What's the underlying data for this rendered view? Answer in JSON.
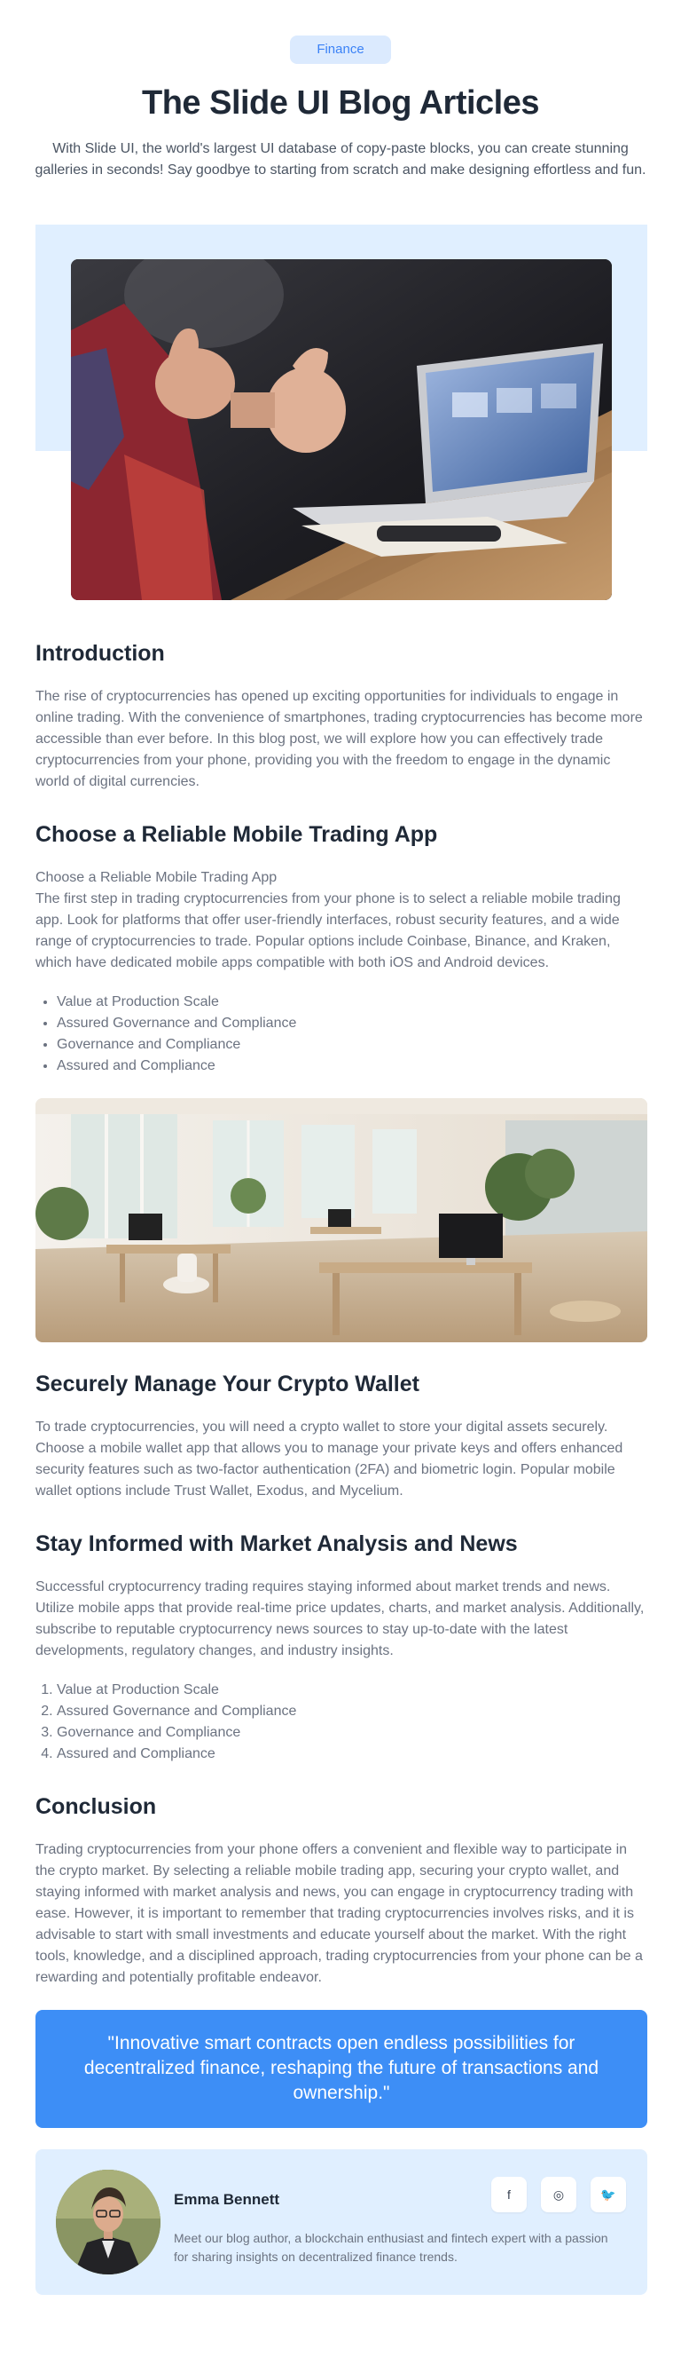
{
  "header": {
    "tag": "Finance",
    "title": "The Slide UI Blog Articles",
    "subtitle": "With Slide UI, the world's largest UI database of copy-paste blocks, you can create stunning galleries in seconds! Say goodbye to starting from scratch and make designing effortless and fun."
  },
  "sections": {
    "intro": {
      "heading": "Introduction",
      "body": "The rise of cryptocurrencies has opened up exciting opportunities for individuals to engage in online trading. With the convenience of smartphones, trading cryptocurrencies has become more accessible than ever before. In this blog post, we will explore how you can effectively trade cryptocurrencies from your phone, providing you with the freedom to engage in the dynamic world of digital currencies."
    },
    "choose": {
      "heading": "Choose a Reliable Mobile Trading App",
      "subheading": "Choose a Reliable Mobile Trading App",
      "body": "The first step in trading cryptocurrencies from your phone is to select a reliable mobile trading app. Look for platforms that offer user-friendly interfaces, robust security features, and a wide range of cryptocurrencies to trade. Popular options include Coinbase, Binance, and Kraken, which have dedicated mobile apps compatible with both iOS and Android devices.",
      "list": [
        "Value at Production Scale",
        "Assured Governance and Compliance",
        "Governance and Compliance",
        "Assured and Compliance"
      ]
    },
    "wallet": {
      "heading": "Securely Manage Your Crypto Wallet",
      "body": "To trade cryptocurrencies, you will need a crypto wallet to store your digital assets securely. Choose a mobile wallet app that allows you to manage your private keys and offers enhanced security features such as two-factor authentication (2FA) and biometric login. Popular mobile wallet options include Trust Wallet, Exodus, and Mycelium."
    },
    "informed": {
      "heading": "Stay Informed with Market Analysis and News",
      "body": "Successful cryptocurrency trading requires staying informed about market trends and news. Utilize mobile apps that provide real-time price updates, charts, and market analysis. Additionally, subscribe to reputable cryptocurrency news sources to stay up-to-date with the latest developments, regulatory changes, and industry insights.",
      "list": [
        "Value at Production Scale",
        "Assured Governance and Compliance",
        "Governance and Compliance",
        "Assured and Compliance"
      ]
    },
    "conclusion": {
      "heading": "Conclusion",
      "body": "Trading cryptocurrencies from your phone offers a convenient and flexible way to participate in the crypto market. By selecting a reliable mobile trading app, securing your crypto wallet, and staying informed with market analysis and news, you can engage in cryptocurrency trading with ease. However, it is important to remember that trading cryptocurrencies involves risks, and it is advisable to start with small investments and educate yourself about the market. With the right tools, knowledge, and a disciplined approach, trading cryptocurrencies from your phone can be a rewarding and potentially profitable endeavor."
    }
  },
  "quote": "\"Innovative smart contracts open endless possibilities for decentralized finance, reshaping the future of transactions and ownership.\"",
  "author": {
    "name": "Emma Bennett",
    "bio": "Meet our blog author, a blockchain enthusiast and fintech expert with a passion for sharing insights on decentralized finance trends.",
    "socials": [
      {
        "icon": "facebook-icon",
        "glyph": "f"
      },
      {
        "icon": "instagram-icon",
        "glyph": "◎"
      },
      {
        "icon": "twitter-icon",
        "glyph": "🐦"
      }
    ]
  },
  "colors": {
    "accent": "#3d8ef6",
    "tag_bg": "#dbeafe",
    "band_bg": "#e0efff"
  }
}
